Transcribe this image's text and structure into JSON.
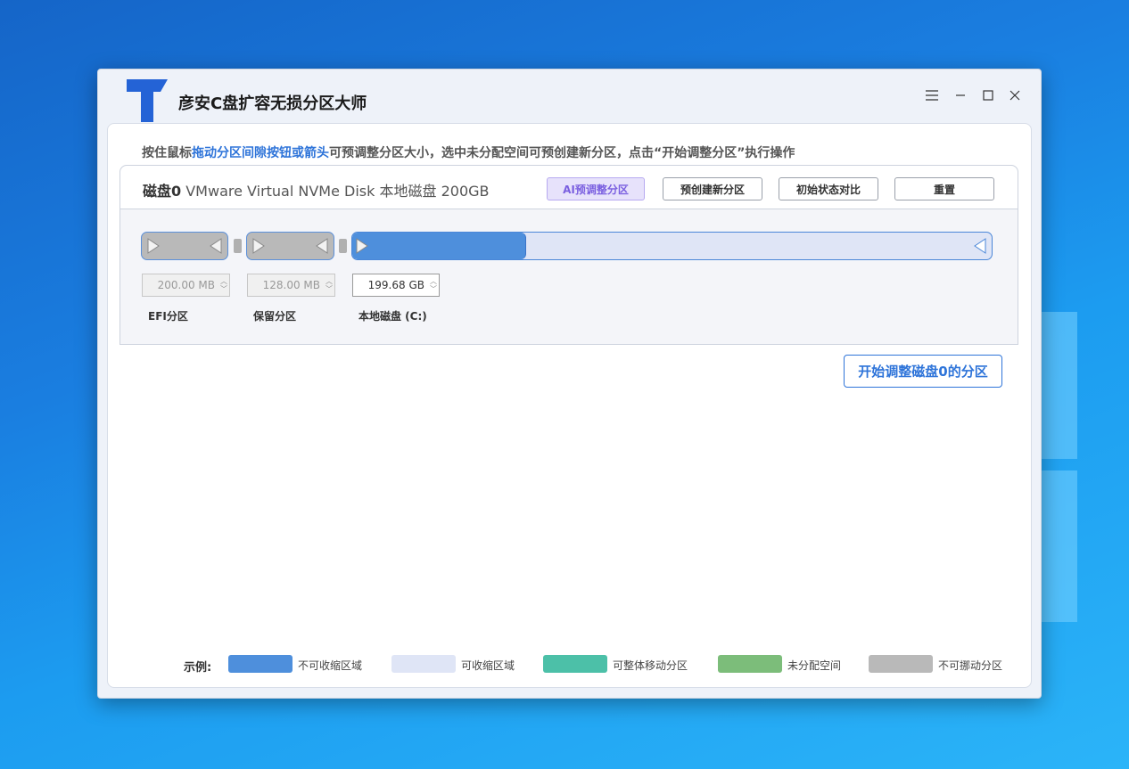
{
  "app": {
    "title": "彦安C盘扩容无损分区大师"
  },
  "hint": {
    "prefix": "按住鼠标",
    "highlight": "拖动分区间隙按钮或箭头",
    "suffix": "可预调整分区大小，选中未分配空间可预创建新分区，点击“开始调整分区”执行操作"
  },
  "disk": {
    "name_bold": "磁盘0",
    "description": " VMware Virtual NVMe Disk 本地磁盘 200GB",
    "buttons": {
      "ai": "AI预调整分区",
      "precreate": "预创建新分区",
      "compare": "初始状态对比",
      "reset": "重置"
    }
  },
  "partitions": [
    {
      "label": "EFI分区",
      "size": "200.00 MB"
    },
    {
      "label": "保留分区",
      "size": "128.00 MB"
    },
    {
      "label": "本地磁盘 (C:)",
      "size": "199.68 GB",
      "used_fraction": 0.27
    }
  ],
  "start_button": "开始调整磁盘0的分区",
  "legend": {
    "title": "示例:",
    "items": [
      {
        "label": "不可收缩区域",
        "color": "#4e8fdc"
      },
      {
        "label": "可收缩区域",
        "color": "#dfe5f6"
      },
      {
        "label": "可整体移动分区",
        "color": "#4cc0a8"
      },
      {
        "label": "未分配空间",
        "color": "#7cbd7a"
      },
      {
        "label": "不可挪动分区",
        "color": "#b9b9b9"
      }
    ]
  }
}
